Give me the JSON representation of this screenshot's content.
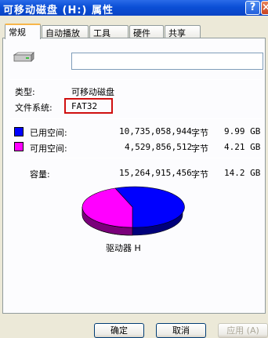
{
  "window": {
    "title": "可移动磁盘 (H:) 属性",
    "help_label": "?",
    "close_label": "×"
  },
  "tabs": [
    {
      "label": "常规"
    },
    {
      "label": "自动播放"
    },
    {
      "label": "工具"
    },
    {
      "label": "硬件"
    },
    {
      "label": "共享"
    }
  ],
  "general": {
    "volume_name": "",
    "type_label": "类型:",
    "type_value": "可移动磁盘",
    "fs_label": "文件系统:",
    "fs_value": "FAT32",
    "used": {
      "label": "已用空间:",
      "bytes": "10,735,058,944",
      "unit": "字节",
      "size": "9.99 GB",
      "color": "#0000ff"
    },
    "free": {
      "label": "可用空间:",
      "bytes": "4,529,856,512",
      "unit": "字节",
      "size": "4.21 GB",
      "color": "#ff00ff"
    },
    "capacity": {
      "label": "容量:",
      "bytes": "15,264,915,456",
      "unit": "字节",
      "size": "14.2 GB"
    },
    "drive_label": "驱动器 H"
  },
  "buttons": {
    "ok": "确定",
    "cancel": "取消",
    "apply": "应用 (A)"
  }
}
